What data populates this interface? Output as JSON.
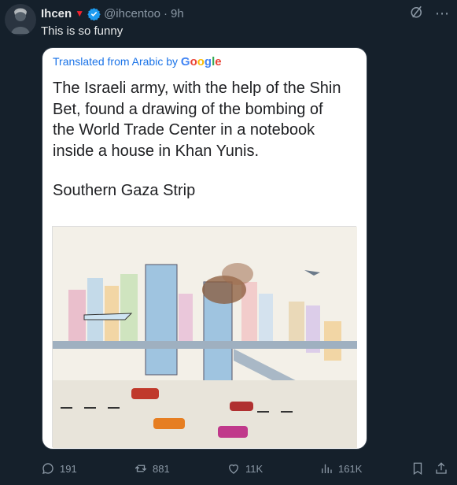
{
  "tweet": {
    "display_name": "Ihcen",
    "handle": "@ihcentoo",
    "separator": "·",
    "time": "9h",
    "text": "This is so funny"
  },
  "card": {
    "translated_prefix": "Translated from Arabic by ",
    "google_letters": [
      "G",
      "o",
      "o",
      "g",
      "l",
      "e"
    ],
    "body_line1": "The Israeli army, with the help of the Shin",
    "body_line2": "Bet, found a drawing of the bombing of",
    "body_line3": "the World Trade Center in a notebook",
    "body_line4": "inside a house in Khan Yunis.",
    "location": "Southern Gaza Strip"
  },
  "actions": {
    "replies": "191",
    "reposts": "881",
    "likes": "11K",
    "views": "161K"
  },
  "colors": {
    "background": "#15202b",
    "text": "#e7e9ea",
    "muted": "#8b98a5",
    "verified": "#1d9bf0",
    "badge_red": "#f4212e",
    "link_blue": "#1a73e8"
  }
}
